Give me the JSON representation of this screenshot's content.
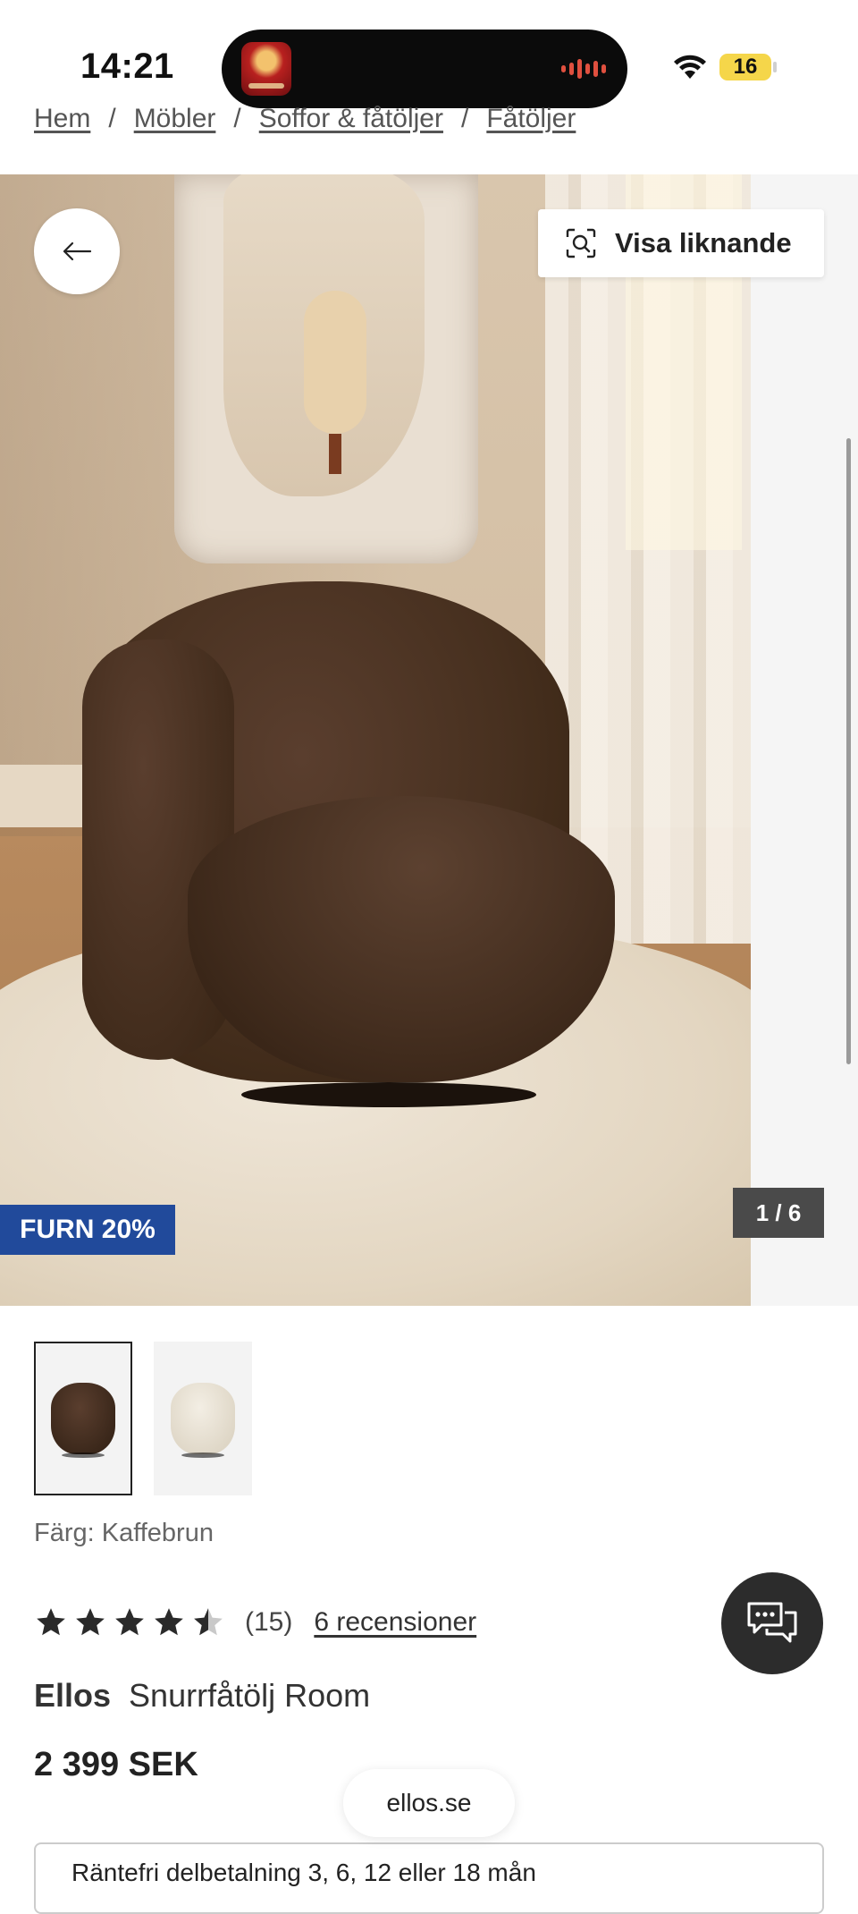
{
  "status_bar": {
    "time": "14:21",
    "battery": "16"
  },
  "breadcrumb": [
    "Hem",
    "Möbler",
    "Soffor & fåtöljer",
    "Fåtöljer"
  ],
  "gallery": {
    "visa_liknande": "Visa liknande",
    "badge": "FURN 20%",
    "counter": "1 / 6",
    "thumbnails": [
      {
        "name": "Kaffebrun",
        "color": "#3b2a20",
        "selected": true
      },
      {
        "name": "Beige",
        "color": "#e6dfd0",
        "selected": false
      }
    ]
  },
  "product": {
    "color_label": "Färg: Kaffebrun",
    "rating_value": 4.5,
    "rating_count": "(15)",
    "reviews_link": "6 recensioner",
    "brand": "Ellos",
    "name": "Snurrfåtölj Room",
    "price": "2 399 SEK"
  },
  "browser": {
    "url": "ellos.se"
  },
  "payment": {
    "text": "Räntefri delbetalning 3, 6, 12 eller 18 mån"
  },
  "icons": [
    "back-arrow-icon",
    "visual-search-icon",
    "chat-icon",
    "star-icon",
    "wifi-icon"
  ],
  "colors": {
    "badge": "#214a9b",
    "counter_bg": "#4a4a4a",
    "chat_bg": "#2c2c2c"
  }
}
